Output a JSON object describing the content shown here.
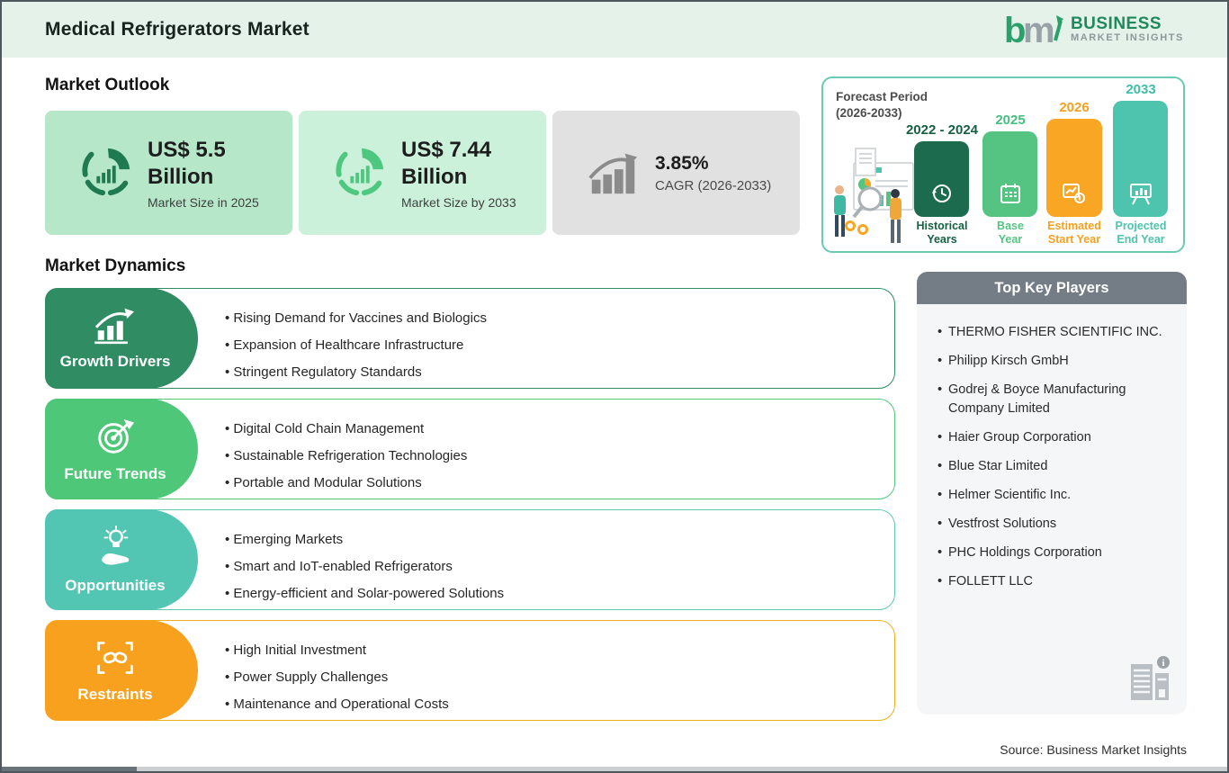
{
  "header": {
    "title": "Medical Refrigerators Market",
    "logo": {
      "mark": "bmi",
      "line1": "BUSINESS",
      "line2": "MARKET  INSIGHTS"
    }
  },
  "market_outlook": {
    "heading": "Market Outlook",
    "cards": [
      {
        "value": "US$ 5.5",
        "unit": "Billion",
        "label": "Market Size in 2025",
        "icon": "donut-chart-icon",
        "bg": "#b5e7c8",
        "icon_color": "#1f7a51"
      },
      {
        "value": "US$ 7.44",
        "unit": "Billion",
        "label": "Market Size by 2033",
        "icon": "donut-chart-icon",
        "bg": "#cbf1da",
        "icon_color": "#4ec77f"
      },
      {
        "value": "3.85%",
        "unit": "",
        "label": "CAGR (2026-2033)",
        "icon": "growth-chart-icon",
        "bg": "#e1e1e1",
        "icon_color": "#8b8b8b"
      }
    ]
  },
  "forecast_panel": {
    "title_line1": "Forecast Period",
    "title_line2": "(2026-2033)",
    "bars": [
      {
        "year": "2022 - 2024",
        "label1": "Historical",
        "label2": "Years",
        "color": "#1d6b4e",
        "icon": "history-clock-icon"
      },
      {
        "year": "2025",
        "label1": "Base",
        "label2": "Year",
        "color": "#55c482",
        "icon": "calendar-icon"
      },
      {
        "year": "2026",
        "label1": "Estimated",
        "label2": "Start Year",
        "color": "#f8a623",
        "icon": "estimate-gauge-icon"
      },
      {
        "year": "2033",
        "label1": "Projected",
        "label2": "End Year",
        "color": "#4ec3ae",
        "icon": "projection-board-icon"
      }
    ]
  },
  "market_dynamics": {
    "heading": "Market Dynamics",
    "rows": [
      {
        "title": "Growth Drivers",
        "color": "#2f8c63",
        "icon": "growth-bars-icon",
        "bullets": [
          "Rising Demand for Vaccines and Biologics",
          "Expansion of Healthcare Infrastructure",
          "Stringent Regulatory Standards"
        ]
      },
      {
        "title": "Future Trends",
        "color": "#4ec878",
        "icon": "target-icon",
        "bullets": [
          "Digital Cold Chain Management",
          "Sustainable Refrigeration Technologies",
          "Portable and Modular Solutions"
        ]
      },
      {
        "title": "Opportunities",
        "color": "#52c6b3",
        "icon": "bulb-hand-icon",
        "bullets": [
          "Emerging Markets",
          "Smart and IoT-enabled Refrigerators",
          "Energy-efficient and Solar-powered Solutions"
        ]
      },
      {
        "title": "Restraints",
        "color": "#f7a11f",
        "icon": "chain-icon",
        "bullets": [
          "High Initial Investment",
          "Power Supply Challenges",
          "Maintenance and Operational Costs"
        ]
      }
    ]
  },
  "key_players": {
    "heading": "Top Key Players",
    "players": [
      "THERMO FISHER SCIENTIFIC INC.",
      "Philipp Kirsch GmbH",
      "Godrej & Boyce Manufacturing Company Limited",
      "Haier Group Corporation",
      "Blue Star Limited",
      "Helmer Scientific Inc.",
      "Vestfrost Solutions",
      "PHC Holdings Corporation",
      "FOLLETT LLC"
    ],
    "icon": "building-icon"
  },
  "source": "Source: Business Market Insights",
  "colors": {
    "header_bg": "#e4f2ea",
    "dark_green": "#1d6b4e",
    "green": "#55c482",
    "teal": "#4ec3ae",
    "orange": "#f8a623",
    "sidebar_header": "#747c85",
    "sidebar_body": "#f4f6f7",
    "card_gray": "#e1e1e1"
  }
}
